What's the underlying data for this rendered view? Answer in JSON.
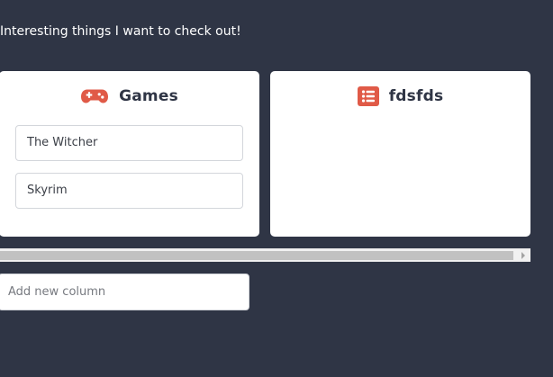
{
  "board": {
    "subtitle": "Interesting things I want to check out!"
  },
  "columns": [
    {
      "title": "Games",
      "icon": "gamepad-icon",
      "cards": [
        "The Witcher",
        "Skyrim"
      ]
    },
    {
      "title": "fdsfds",
      "icon": "list-icon",
      "cards": []
    }
  ],
  "new_column": {
    "placeholder": "Add new column",
    "value": ""
  },
  "colors": {
    "background": "#2f3545",
    "accent": "#e05a47",
    "card_border": "#d3d6db"
  }
}
